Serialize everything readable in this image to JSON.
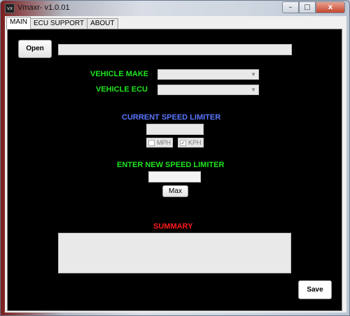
{
  "window": {
    "title": "Vmaxr- v1.0.01",
    "icon_text": "vx",
    "controls": {
      "minimize": "–",
      "maximize": "□",
      "close": "x"
    }
  },
  "tabs": [
    {
      "label": "MAIN",
      "active": true
    },
    {
      "label": "ECU SUPPORT",
      "active": false
    },
    {
      "label": "ABOUT",
      "active": false
    }
  ],
  "main": {
    "open_button": "Open",
    "file_path_value": "",
    "vehicle_make": {
      "label": "VEHICLE MAKE",
      "selected": ""
    },
    "vehicle_ecu": {
      "label": "VEHICLE ECU",
      "selected": ""
    },
    "current_speed_limiter": {
      "label": "CURRENT SPEED LIMITER",
      "value": ""
    },
    "units": {
      "mph": {
        "label": "MPH",
        "checked": false
      },
      "kph": {
        "label": "KPH",
        "checked": true
      }
    },
    "new_speed_limiter": {
      "label": "ENTER NEW SPEED LIMITER",
      "value": ""
    },
    "max_button": "Max",
    "summary": {
      "label": "SUMMARY",
      "value": ""
    },
    "save_button": "Save"
  },
  "colors": {
    "panel_background": "#000000",
    "green_label": "#1ee61e",
    "blue_label": "#5a76ff",
    "red_label": "#ff1a1a"
  }
}
